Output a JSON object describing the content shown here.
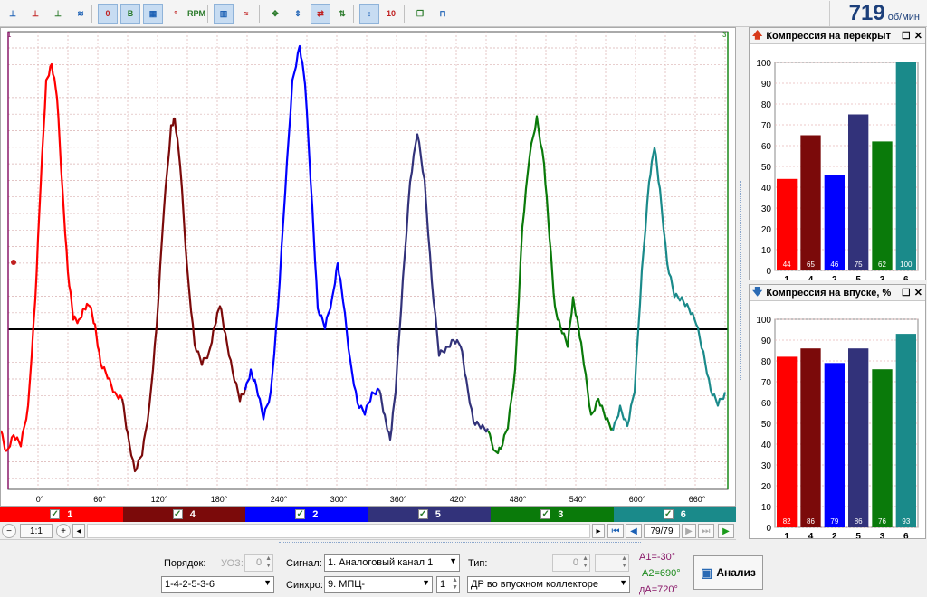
{
  "toolbar": {
    "buttons": [
      {
        "icon": "channels-chart-icon",
        "glyph": "⊥",
        "on": false
      },
      {
        "icon": "trigger-chart-icon",
        "glyph": "⊥",
        "on": false
      },
      {
        "icon": "multi-chart-icon",
        "glyph": "⊥",
        "on": false
      },
      {
        "icon": "wave-check-icon",
        "glyph": "≋",
        "on": false
      },
      {
        "icon": "zero-level-icon",
        "glyph": "0",
        "on": true
      },
      {
        "icon": "bold-icon",
        "glyph": "B",
        "on": true
      },
      {
        "icon": "grid-table-icon",
        "glyph": "▦",
        "on": true
      },
      {
        "icon": "degrees-icon",
        "glyph": "°",
        "on": false
      },
      {
        "icon": "rpm-gauge-icon",
        "glyph": "RPM",
        "on": false
      },
      {
        "icon": "bar-chart-icon",
        "glyph": "▥",
        "on": true
      },
      {
        "icon": "wave-icon",
        "glyph": "≈",
        "on": false
      },
      {
        "icon": "move-icon",
        "glyph": "✥",
        "on": false
      },
      {
        "icon": "vertical-arrows-icon",
        "glyph": "⇕",
        "on": false
      },
      {
        "icon": "flow-icon",
        "glyph": "⇄",
        "on": true
      },
      {
        "icon": "scale-icon",
        "glyph": "⇅",
        "on": false
      },
      {
        "icon": "cursor-icon",
        "glyph": "↕",
        "on": true
      },
      {
        "icon": "ratio-icon",
        "glyph": "10",
        "on": false
      },
      {
        "icon": "copy-icon",
        "glyph": "❐",
        "on": false
      },
      {
        "icon": "sync-icon",
        "glyph": "⊓",
        "on": false
      }
    ]
  },
  "rpm": {
    "value": "719",
    "unit": "об/мин"
  },
  "plot": {
    "x_ticks": [
      "0°",
      "60°",
      "120°",
      "180°",
      "240°",
      "300°",
      "360°",
      "420°",
      "480°",
      "540°",
      "600°",
      "660°"
    ],
    "marker_left": "1",
    "marker_right": "3"
  },
  "channels": [
    {
      "label": "1",
      "color": "#ff0000"
    },
    {
      "label": "4",
      "color": "#7b0a0a"
    },
    {
      "label": "2",
      "color": "#0000ff"
    },
    {
      "label": "5",
      "color": "#32327a"
    },
    {
      "label": "3",
      "color": "#0a7a0a"
    },
    {
      "label": "6",
      "color": "#1a8a8a"
    }
  ],
  "nav": {
    "zoom": "1:1",
    "frame": "79/79"
  },
  "bottom": {
    "order_label": "Порядок:",
    "uoz_label": "УОЗ:",
    "uoz_value": "0",
    "order_value": "1-4-2-5-3-6",
    "signal_label": "Сигнал:",
    "signal_value": "1. Аналоговый канал 1",
    "type_label": "Тип:",
    "type_value": "0",
    "sync_label": "Синхро:",
    "sync_value": "9. МПЦ-",
    "sync_num": "1",
    "sync_type": "ДР во впускном коллекторе",
    "a1": "A1=-30°",
    "a2": "A2=690°",
    "da": "дA=720°",
    "analyze": "Анализ"
  },
  "panel_top": {
    "title": "Компрессия на перекрыт",
    "chart_data": {
      "type": "bar",
      "categories": [
        "1",
        "4",
        "2",
        "5",
        "3",
        "6"
      ],
      "values": [
        44,
        65,
        46,
        75,
        62,
        100
      ],
      "colors": [
        "#ff0000",
        "#7b0a0a",
        "#0000ff",
        "#32327a",
        "#0a7a0a",
        "#1a8a8a"
      ],
      "ylim": [
        0,
        100
      ],
      "yticks": [
        "0",
        "10",
        "20",
        "30",
        "40",
        "50",
        "60",
        "70",
        "80",
        "90",
        "100"
      ]
    }
  },
  "panel_bottom": {
    "title": "Компрессия на впуске, %",
    "chart_data": {
      "type": "bar",
      "categories": [
        "1",
        "4",
        "2",
        "5",
        "3",
        "6"
      ],
      "values": [
        82,
        86,
        79,
        86,
        76,
        93
      ],
      "colors": [
        "#ff0000",
        "#7b0a0a",
        "#0000ff",
        "#32327a",
        "#0a7a0a",
        "#1a8a8a"
      ],
      "ylim": [
        0,
        100
      ],
      "yticks": [
        "0",
        "10",
        "20",
        "30",
        "40",
        "50",
        "60",
        "70",
        "80",
        "90",
        "100"
      ]
    }
  }
}
